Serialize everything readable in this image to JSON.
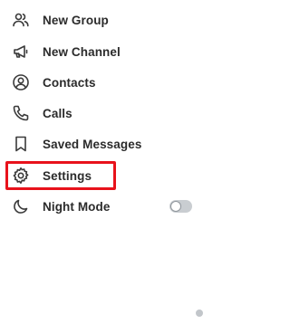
{
  "menu": {
    "items": [
      {
        "label": "New Group",
        "icon": "group-icon"
      },
      {
        "label": "New Channel",
        "icon": "megaphone-icon"
      },
      {
        "label": "Contacts",
        "icon": "contact-icon"
      },
      {
        "label": "Calls",
        "icon": "phone-icon"
      },
      {
        "label": "Saved Messages",
        "icon": "bookmark-icon"
      },
      {
        "label": "Settings",
        "icon": "gear-icon"
      },
      {
        "label": "Night Mode",
        "icon": "moon-icon"
      }
    ],
    "night_mode_enabled": false,
    "highlighted_item": "Settings"
  },
  "colors": {
    "highlight": "#e8121b",
    "toggle_off": "#c9cdd1"
  }
}
